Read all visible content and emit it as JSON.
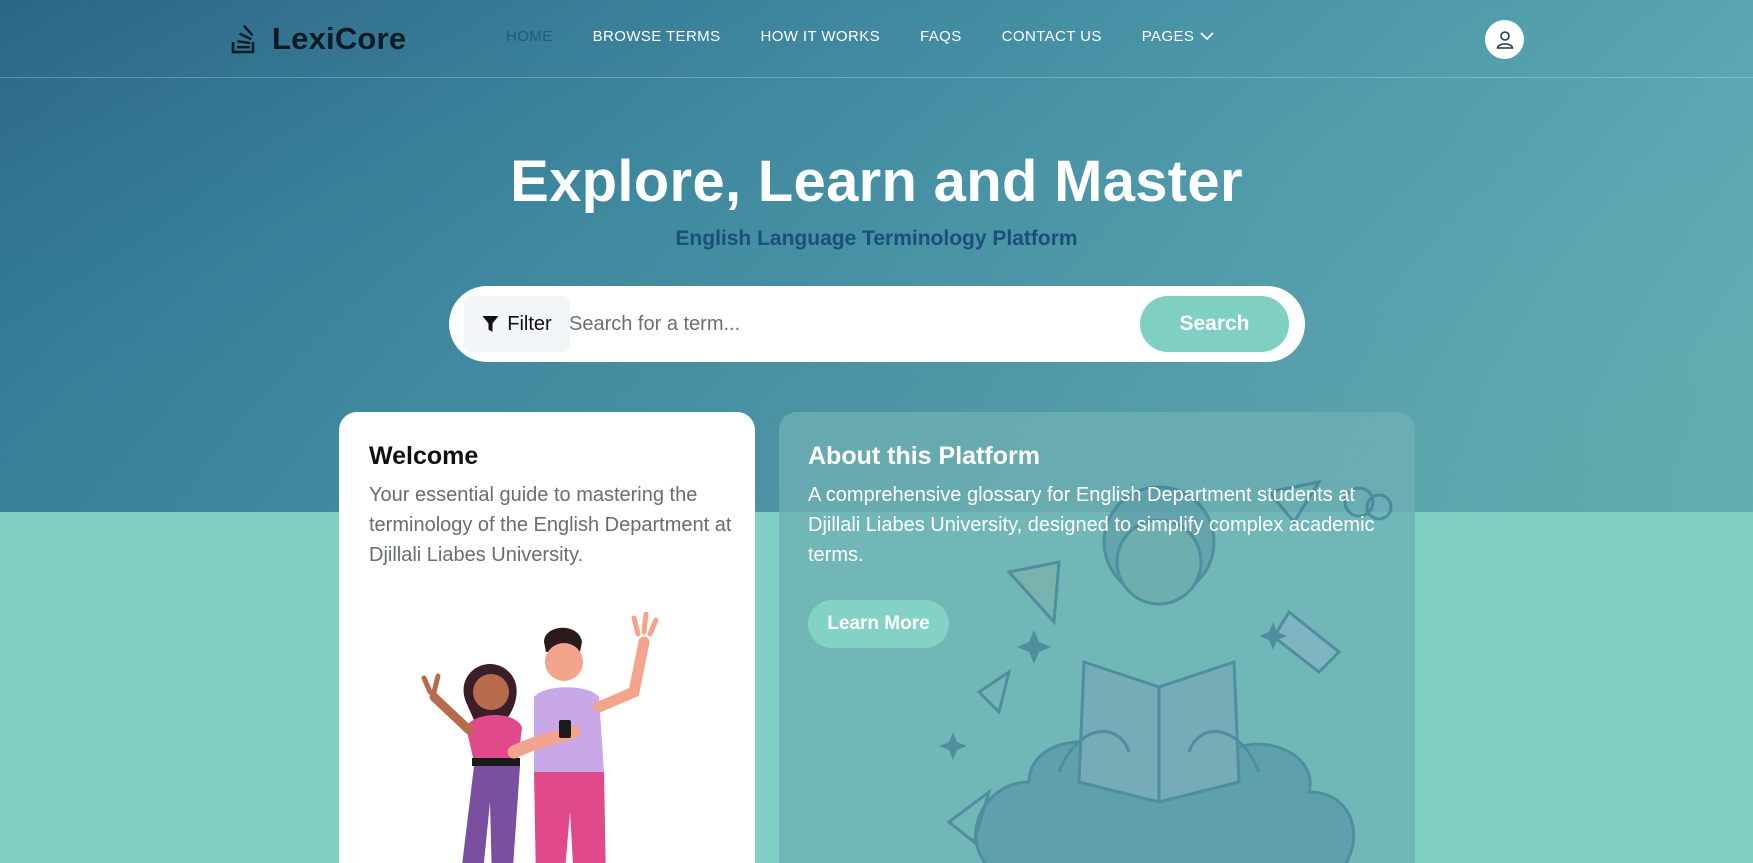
{
  "brand": {
    "name": "LexiCore",
    "logo_icon": "stack-overflow-style-icon"
  },
  "nav": {
    "items": [
      {
        "label": "HOME",
        "active": true
      },
      {
        "label": "BROWSE TERMS",
        "active": false
      },
      {
        "label": "HOW IT WORKS",
        "active": false
      },
      {
        "label": "FAQS",
        "active": false
      },
      {
        "label": "CONTACT US",
        "active": false
      },
      {
        "label": "PAGES",
        "active": false,
        "has_dropdown": true
      }
    ],
    "user_icon": "user-icon"
  },
  "hero": {
    "title": "Explore, Learn and Master",
    "subtitle": "English Language Terminology Platform"
  },
  "search": {
    "filter_label": "Filter",
    "placeholder": "Search for a term...",
    "value": "",
    "button_label": "Search"
  },
  "welcome_card": {
    "title": "Welcome",
    "text": "Your essential guide to mastering the terminology of the English Department at Djillali Liabes University."
  },
  "about_card": {
    "title": "About this Platform",
    "text": "A comprehensive glossary for English Department students at Djillali Liabes University, designed to simplify complex academic terms.",
    "button_label": "Learn More"
  },
  "colors": {
    "accent": "#7fcfc3",
    "hero_dark": "#1f5d80",
    "active_nav": "#1d5b7e",
    "subtitle": "#1a4f7a"
  }
}
